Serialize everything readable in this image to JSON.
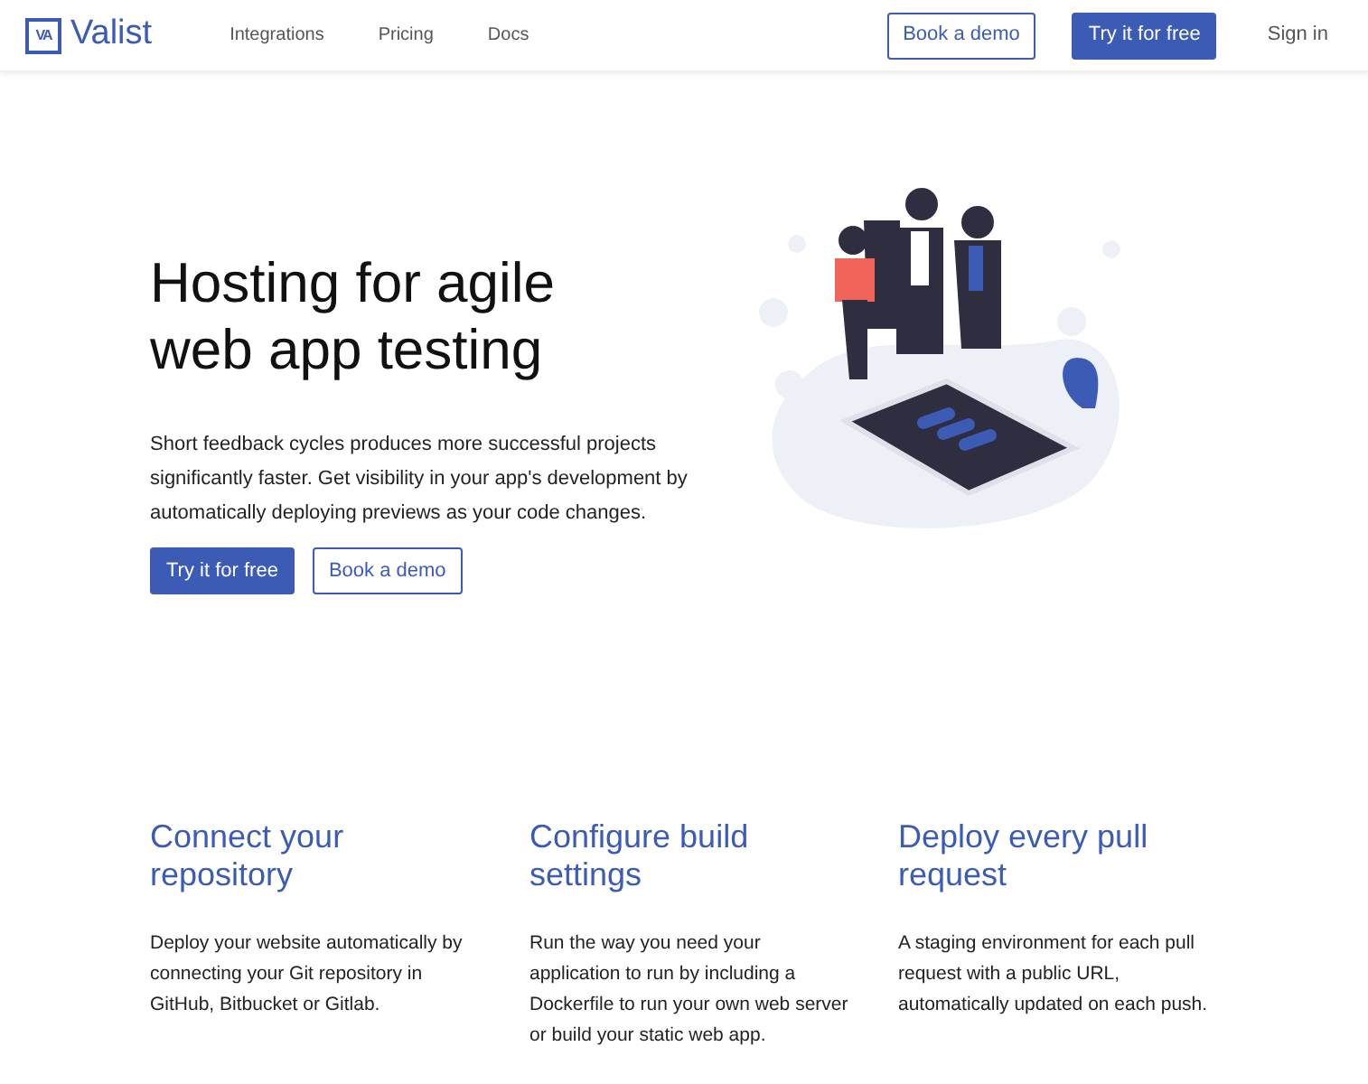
{
  "header": {
    "logo_mark": "VA",
    "logo_text": "Valist",
    "nav": [
      "Integrations",
      "Pricing",
      "Docs"
    ],
    "buttons": [
      {
        "label": "Book a demo",
        "kind": "outline"
      },
      {
        "label": "Try it for free",
        "kind": "primary"
      },
      {
        "label": "Sign in",
        "kind": "plain"
      }
    ]
  },
  "hero": {
    "title": "Hosting for agile web app testing",
    "text": "Short feedback cycles produces more successful projects significantly faster. Get visibility in your app's development by automatically deploying previews as your code changes.",
    "buttons": [
      {
        "label": "Try it for free",
        "kind": "primary"
      },
      {
        "label": "Book a demo",
        "kind": "outline"
      }
    ]
  },
  "features": [
    {
      "title": "Connect your repository",
      "text": "Deploy your website automatically by connecting your Git repository in GitHub, Bitbucket or Gitlab."
    },
    {
      "title": "Configure build settings",
      "text": "Run the way you need your application to run by including a Dockerfile to run your own web server or build your static web app."
    },
    {
      "title": "Deploy every pull request",
      "text": "A staging environment for each pull request with a public URL, automatically updated on each push."
    }
  ]
}
